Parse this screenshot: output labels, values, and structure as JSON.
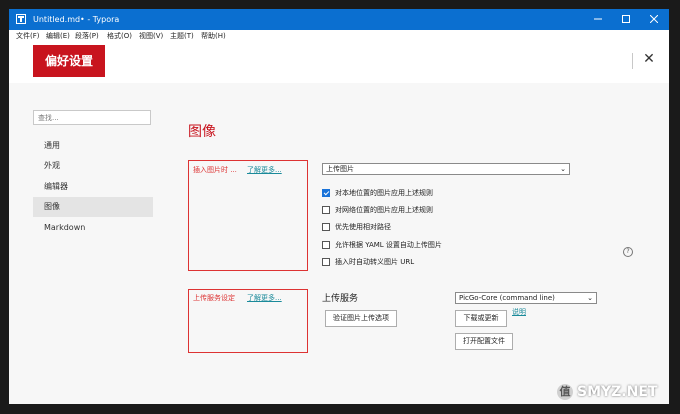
{
  "window": {
    "title": "Untitled.md• - Typora",
    "icon": "typora-app-icon"
  },
  "menu": [
    "文件(F)",
    "编辑(E)",
    "段落(P)",
    "格式(O)",
    "视图(V)",
    "主题(T)",
    "帮助(H)"
  ],
  "header": {
    "title": "偏好设置",
    "close": "✕"
  },
  "sidebar": {
    "search_placeholder": "查找...",
    "items": [
      "通用",
      "外观",
      "编辑器",
      "图像",
      "Markdown"
    ],
    "active": "图像"
  },
  "section": {
    "title": "图像"
  },
  "insert_image": {
    "label": "插入图片时 ...",
    "learn_more": "了解更多...",
    "select_value": "上传图片",
    "options": [
      {
        "label": "对本地位置的图片应用上述规则",
        "checked": true
      },
      {
        "label": "对网络位置的图片应用上述规则",
        "checked": false
      },
      {
        "label": "优先使用相对路径",
        "checked": false
      },
      {
        "label": "允许根据 YAML 设置自动上传图片",
        "checked": false
      },
      {
        "label": "插入时自动转义图片 URL",
        "checked": false
      }
    ],
    "help": "?"
  },
  "upload_service": {
    "label": "上传服务设定",
    "learn_more": "了解更多...",
    "service_label": "上传服务",
    "service_value": "PicGo-Core (command line)",
    "verify_button": "验证图片上传选项",
    "download_button": "下载或更新",
    "explain_link": "说明",
    "open_config_button": "打开配置文件"
  },
  "watermark": {
    "text": "SMYZ.NET",
    "logo_glyph": "值"
  },
  "colors": {
    "titlebar": "#0b6fd0",
    "accent_red": "#c8141e",
    "link": "#1a8a9a",
    "checkbox": "#1a73d9"
  }
}
